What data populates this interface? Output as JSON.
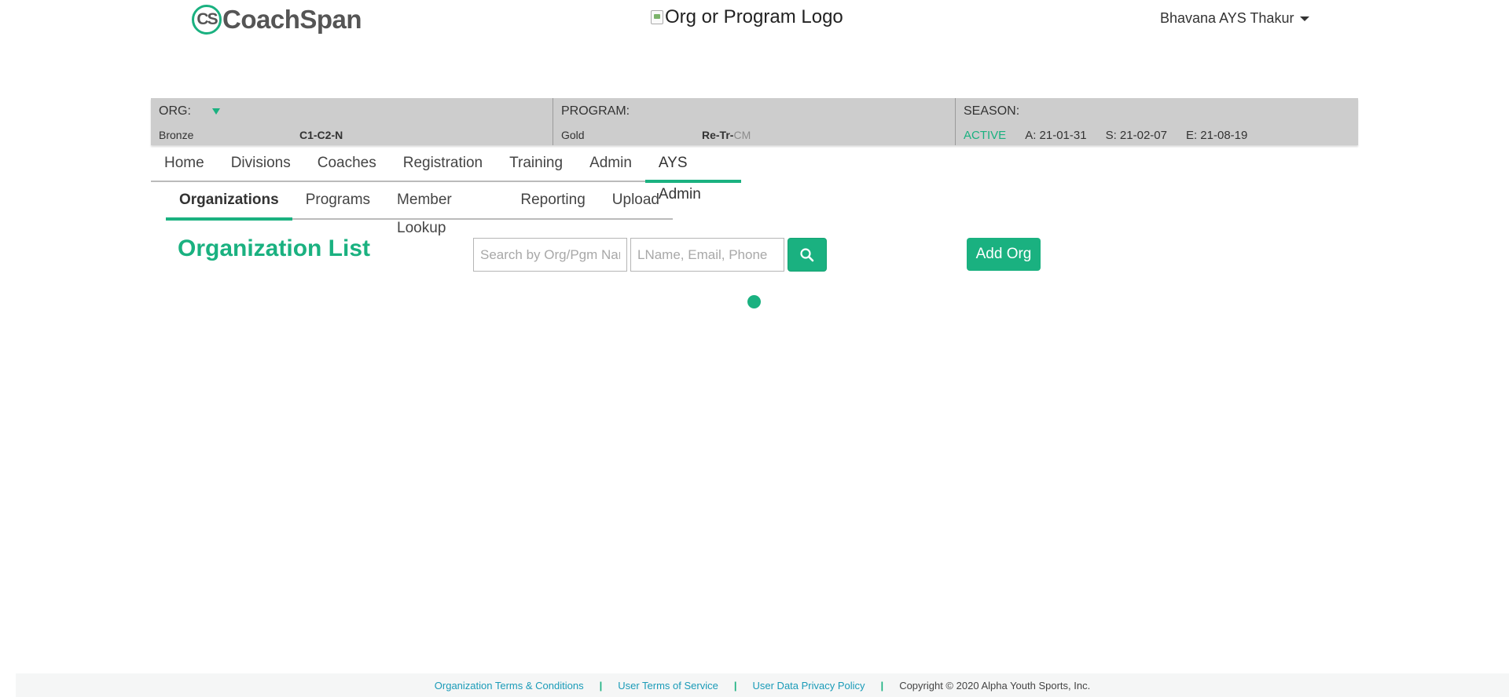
{
  "header": {
    "brand_mark": "CS",
    "brand_name": "CoachSpan",
    "org_logo_alt": "Org or Program Logo",
    "user_name": "Bhavana AYS Thakur"
  },
  "context": {
    "org": {
      "label": "ORG:",
      "level": "Bronze",
      "code": "C1-C2-N"
    },
    "program": {
      "label": "PROGRAM:",
      "level": "Gold",
      "code_main": "Re-Tr-",
      "code_faint": "CM"
    },
    "season": {
      "label": "SEASON:",
      "status": "ACTIVE",
      "a_date": "A: 21-01-31",
      "s_date": "S: 21-02-07",
      "e_date": "E: 21-08-19"
    }
  },
  "main_nav": {
    "home": "Home",
    "divisions": "Divisions",
    "coaches": "Coaches",
    "registration": "Registration",
    "training": "Training",
    "admin": "Admin",
    "ays_admin": "AYS Admin"
  },
  "sub_nav": {
    "organizations": "Organizations",
    "programs": "Programs",
    "member_lookup": "Member Lookup",
    "reporting": "Reporting",
    "upload": "Upload"
  },
  "content": {
    "title": "Organization List",
    "search_org_placeholder": "Search by Org/Pgm Name",
    "search_member_placeholder": "LName, Email, Phone",
    "add_button": "Add Org"
  },
  "footer": {
    "org_terms": "Organization Terms & Conditions",
    "user_terms": "User Terms of Service",
    "privacy": "User Data Privacy Policy",
    "copyright": "Copyright © 2020 Alpha Youth Sports, Inc."
  },
  "colors": {
    "accent": "#1ab180",
    "context_bar": "#cdcdcd",
    "footer_link": "#1a9bb8"
  },
  "icons": {
    "search": "search-icon",
    "dropdown": "caret-down-icon",
    "org_dropdown": "triangle-down-icon"
  }
}
